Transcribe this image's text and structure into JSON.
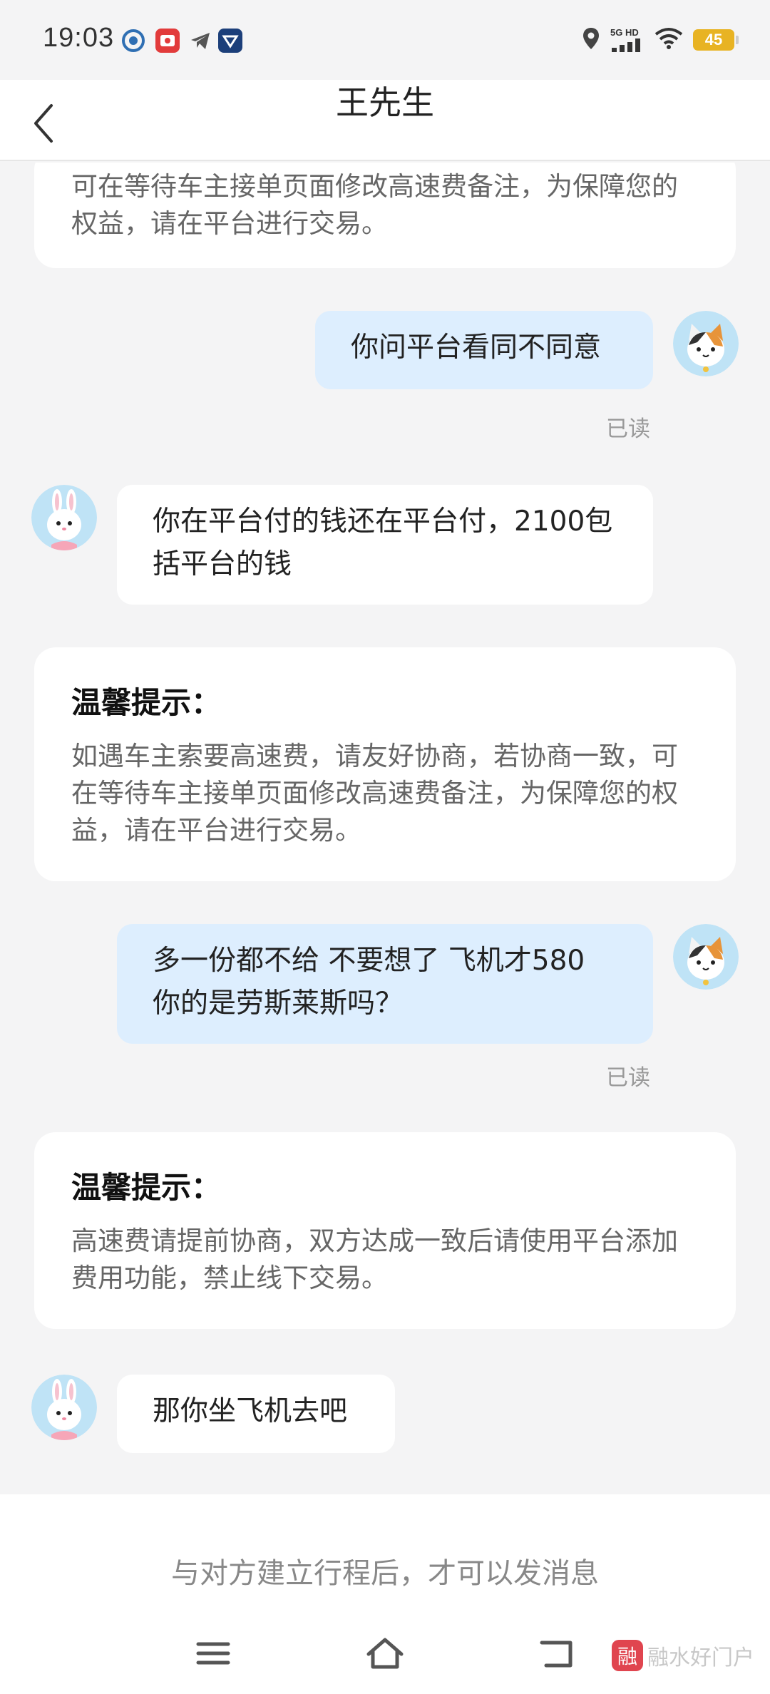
{
  "status_bar": {
    "time": "19:03",
    "network_top": "5G HD",
    "battery": "45",
    "app_icons": [
      "shield-app-icon",
      "red-app-icon",
      "telegram-icon",
      "blue-app-icon"
    ]
  },
  "header": {
    "title": "王先生"
  },
  "messages": {
    "notice_top": {
      "body": "可在等待车主接单页面修改高速费备注，为保障您的权益，请在平台进行交易。"
    },
    "out_1": {
      "text": "你问平台看同不同意",
      "read": "已读"
    },
    "in_1": {
      "text": "你在平台付的钱还在平台付，2100包括平台的钱"
    },
    "notice_1": {
      "title": "温馨提示：",
      "body": "如遇车主索要高速费，请友好协商，若协商一致，可在等待车主接单页面修改高速费备注，为保障您的权益，请在平台进行交易。"
    },
    "out_2": {
      "text": "多一份都不给 不要想了 飞机才580 你的是劳斯莱斯吗？",
      "read": "已读"
    },
    "notice_2": {
      "title": "温馨提示：",
      "body": "高速费请提前协商，双方达成一致后请使用平台添加费用功能，禁止线下交易。"
    },
    "in_2": {
      "text": "那你坐飞机去吧"
    }
  },
  "footer": {
    "hint": "与对方建立行程后，才可以发消息"
  },
  "watermark": {
    "logo": "融",
    "text": "融水好门户"
  },
  "colors": {
    "outgoing_bubble": "#ddeefe",
    "incoming_bubble": "#ffffff",
    "background": "#f4f4f5",
    "battery": "#e8b323"
  }
}
